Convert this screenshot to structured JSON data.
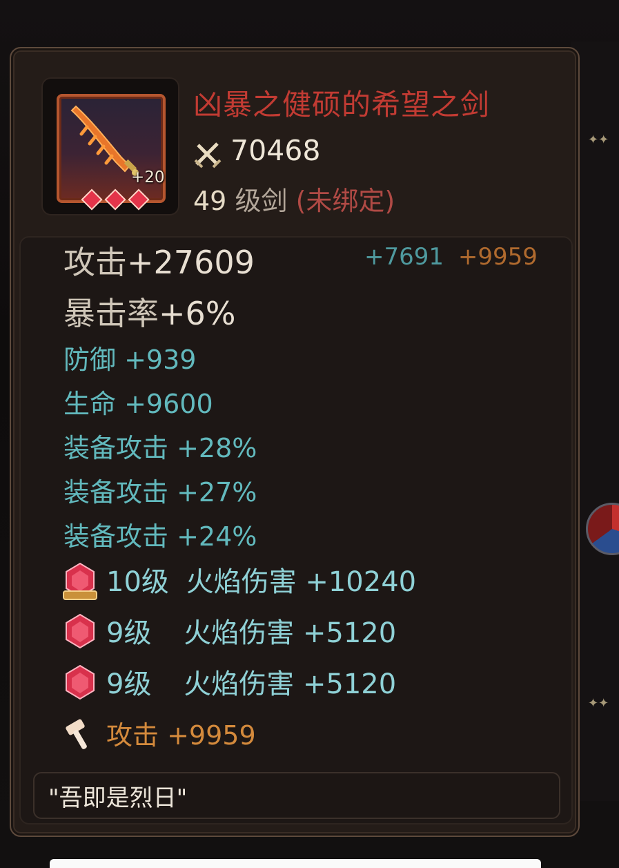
{
  "item": {
    "name": "凶暴之健硕的希望之剑",
    "enhance": "+20",
    "power": "70468",
    "level": "49",
    "type": "级剑",
    "binding": "(未绑定)"
  },
  "main_stats": [
    {
      "label": "攻击",
      "value": "+27609"
    },
    {
      "label": "暴击率",
      "value": "+6%"
    }
  ],
  "attack_bonus": {
    "enhance": "+7691",
    "forge": "+9959"
  },
  "sub_stats": [
    "防御 +939",
    "生命 +9600",
    "装备攻击 +28%",
    "装备攻击 +27%",
    "装备攻击 +24%"
  ],
  "gems": [
    {
      "level": "10级",
      "effect": "火焰伤害 +10240"
    },
    {
      "level": "9级",
      "effect": "火焰伤害 +5120"
    },
    {
      "level": "9级",
      "effect": "火焰伤害 +5120"
    }
  ],
  "forge": {
    "effect": "攻击 +9959"
  },
  "flavor_text": "\"吾即是烈日\"",
  "colors": {
    "title": "#c23b33",
    "sub_stat": "#62b9bd",
    "gem_text": "#8fd1d6",
    "forge_text": "#d48a3c",
    "panel_bg": "#241c18"
  }
}
